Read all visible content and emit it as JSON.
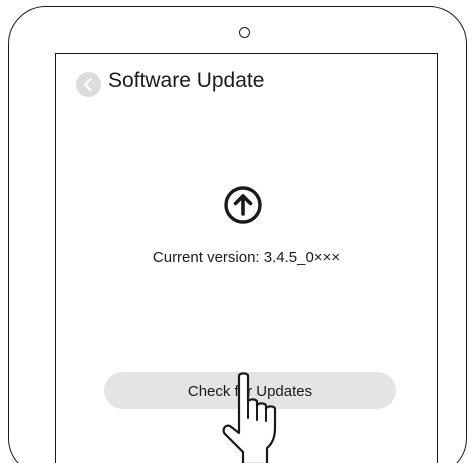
{
  "screen": {
    "title": "Software Update",
    "version_text": "Current version: 3.4.5_0×××",
    "check_button_label": "Check for Updates"
  },
  "icons": {
    "back": "chevron-left-icon",
    "update": "arrow-up-circle-icon",
    "pointer": "pointing-hand-icon"
  },
  "colors": {
    "outline": "#1a1a1a",
    "back_button_bg": "#dcdcdc",
    "check_button_bg": "#e4e4e4",
    "background": "#ffffff"
  }
}
